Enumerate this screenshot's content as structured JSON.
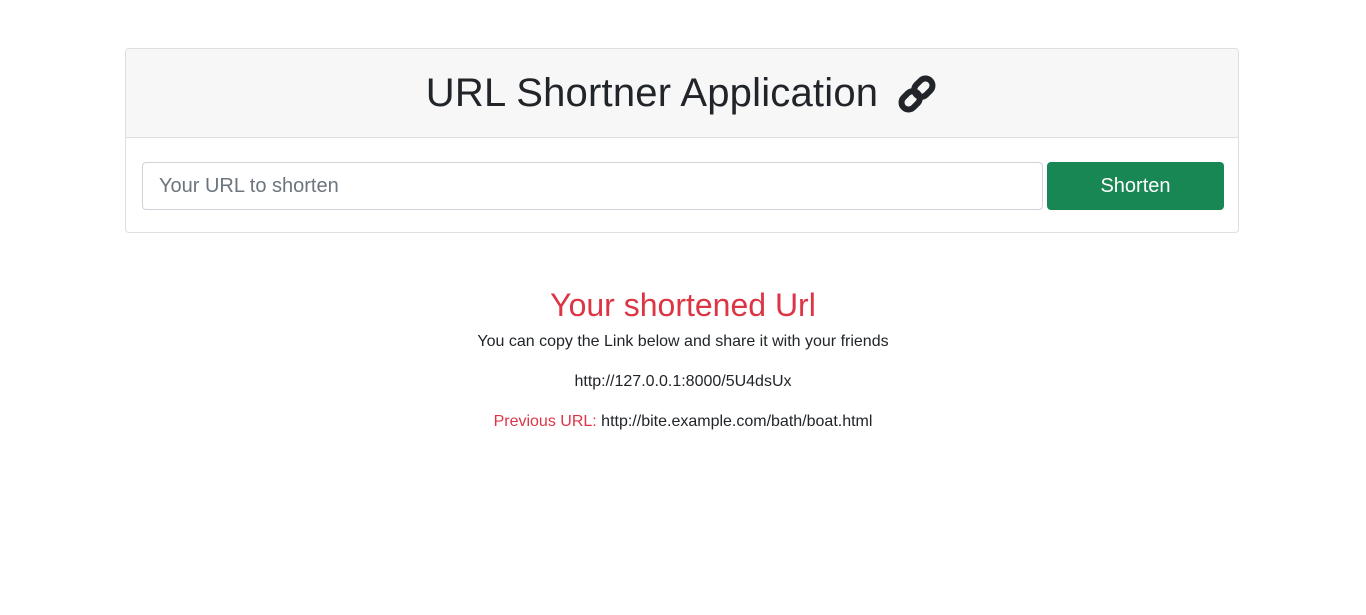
{
  "header": {
    "title": "URL Shortner Application",
    "icon": "link-icon"
  },
  "form": {
    "url_placeholder": "Your URL to shorten",
    "url_value": "",
    "shorten_label": "Shorten"
  },
  "result": {
    "heading": "Your shortened Url",
    "description": "You can copy the Link below and share it with your friends",
    "short_url": "http://127.0.0.1:8000/5U4dsUx",
    "previous_label": "Previous URL:",
    "previous_url": "http://bite.example.com/bath/boat.html"
  },
  "colors": {
    "accent_red": "#dc3545",
    "button_green": "#198754",
    "header_bg": "#f7f7f7"
  }
}
